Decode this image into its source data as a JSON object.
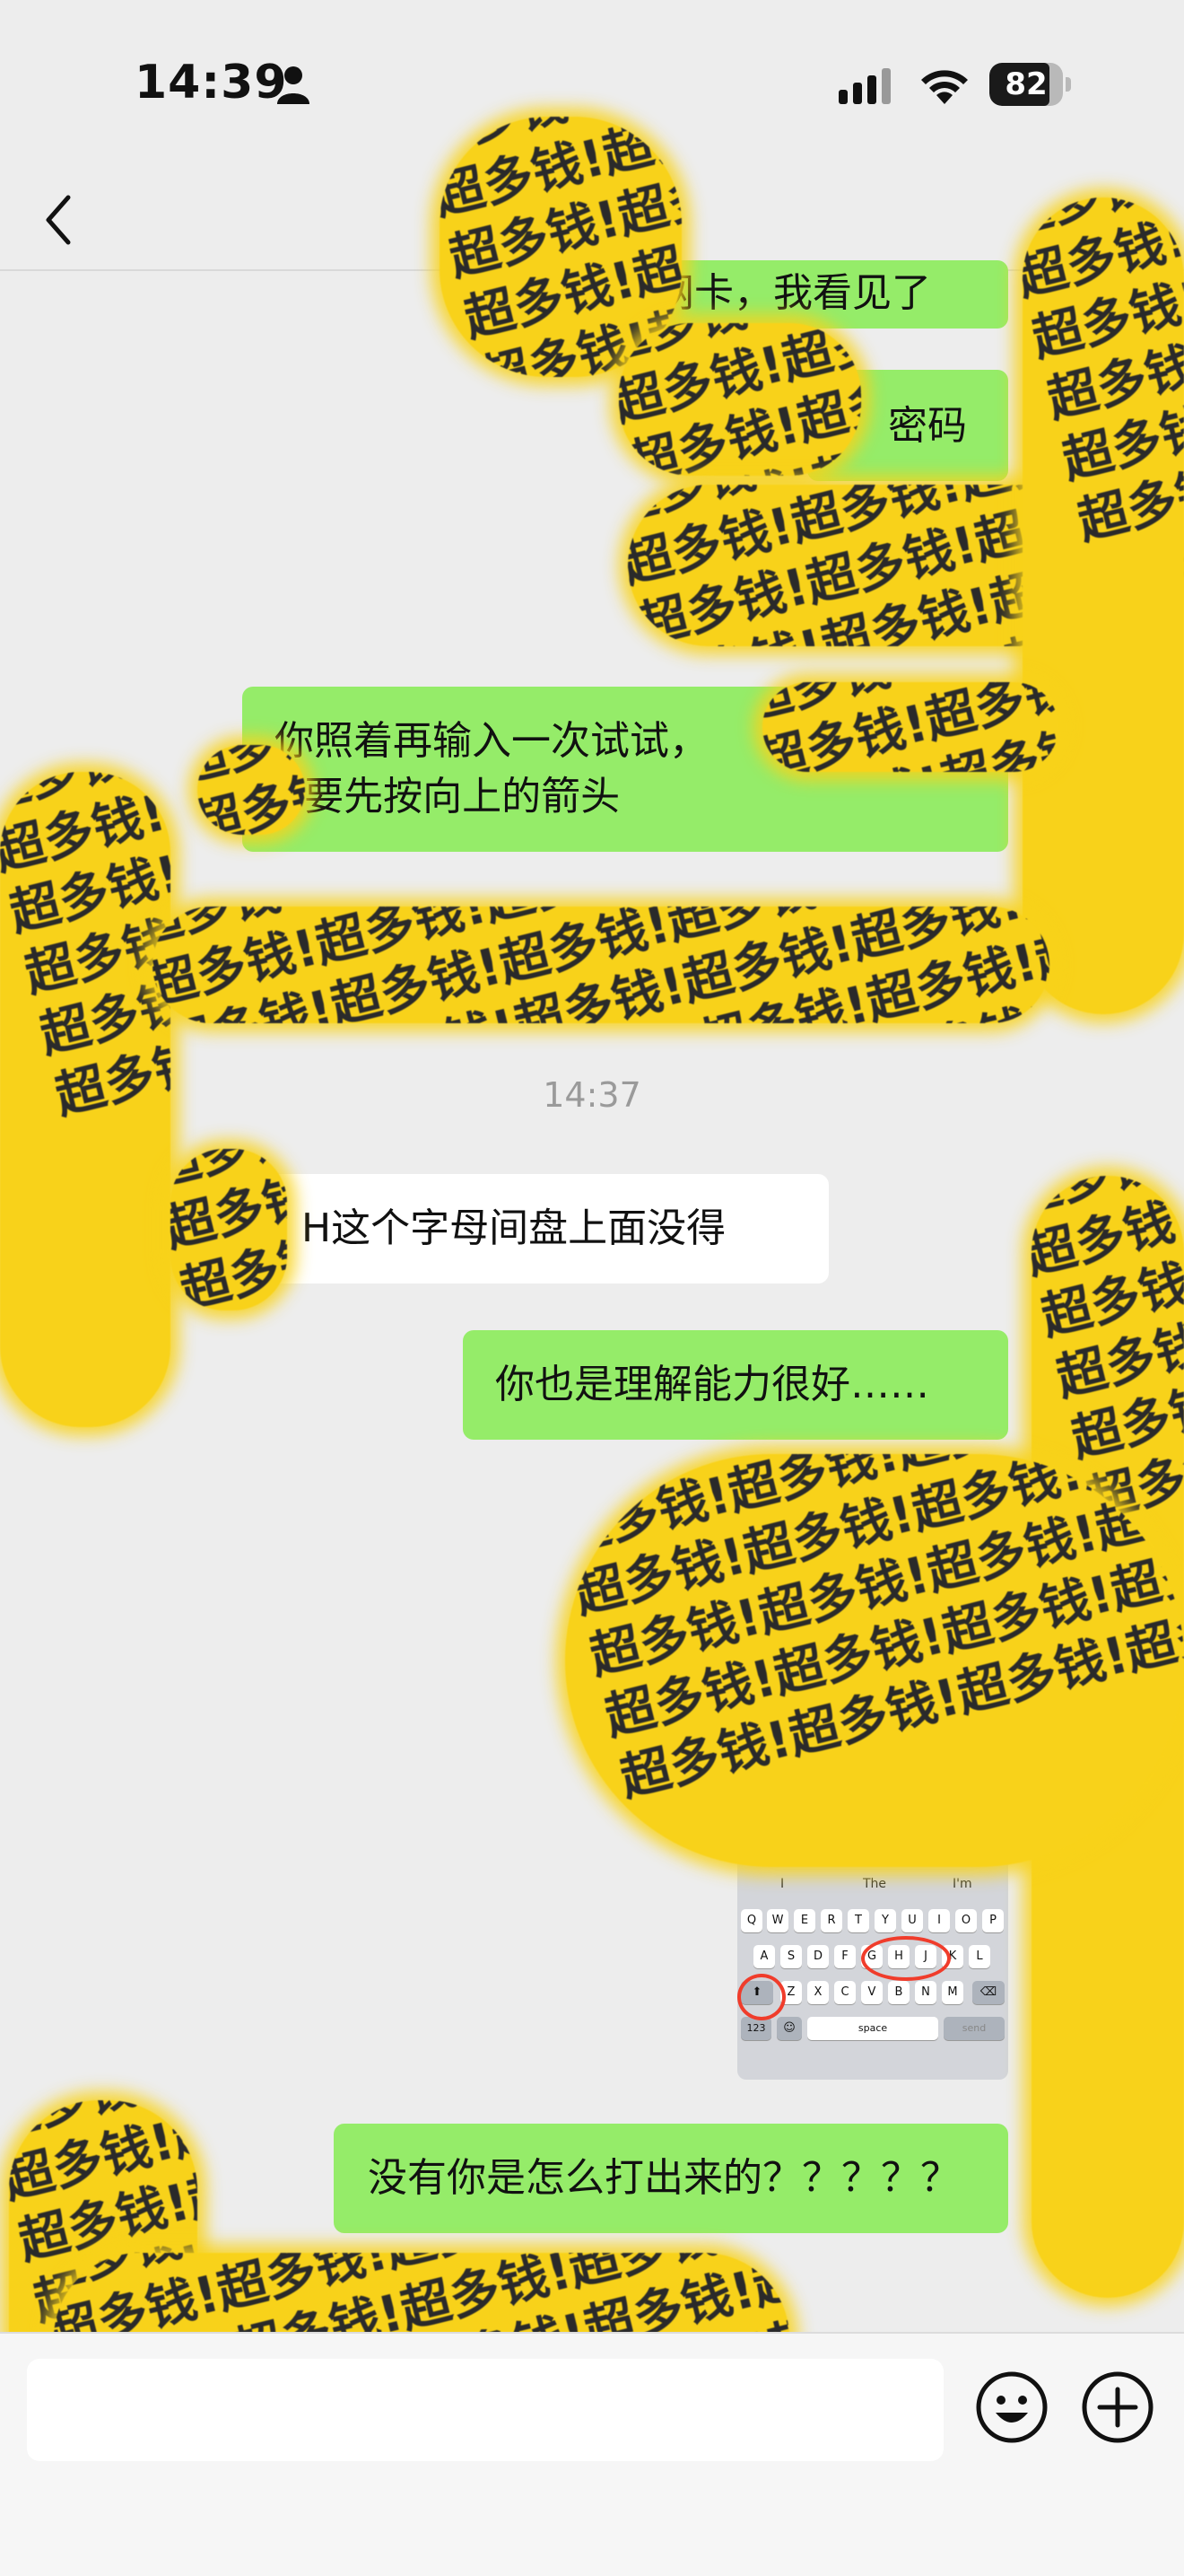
{
  "status_bar": {
    "time": "14:39",
    "battery": "82",
    "battery_level": 0.82
  },
  "nav": {
    "title": ")"
  },
  "messages": [
    {
      "id": "m1",
      "side": "right",
      "color": "green",
      "text": "网卡，我看见了"
    },
    {
      "id": "m2",
      "side": "right",
      "color": "green",
      "text": "密码"
    },
    {
      "id": "m3",
      "side": "right",
      "color": "green",
      "line1": "你照着再输入一次试试，",
      "line2": "H要先按向上的箭头"
    },
    {
      "id": "m4",
      "side": "left",
      "color": "white",
      "text": "H这个字母间盘上面没得"
    },
    {
      "id": "m5",
      "side": "right",
      "color": "green",
      "text": "你也是理解能力很好……"
    },
    {
      "id": "m6",
      "side": "right",
      "color": "green",
      "text": "没有你是怎么打出来的？？？？？"
    }
  ],
  "timestamp": "14:37",
  "keyboard_image": {
    "suggestions": [
      "I",
      "The",
      "I'm"
    ],
    "row1": [
      "Q",
      "W",
      "E",
      "R",
      "T",
      "Y",
      "U",
      "I",
      "O",
      "P"
    ],
    "row2": [
      "A",
      "S",
      "D",
      "F",
      "G",
      "H",
      "J",
      "K",
      "L"
    ],
    "row3": [
      "Z",
      "X",
      "C",
      "V",
      "B",
      "N",
      "M"
    ],
    "mode_key": "123",
    "space_key": "space",
    "send_key": "send"
  },
  "sticker_text": "超多钱!超多钱!超多钱!超多钱!超多钱!超多钱!超多钱!超多钱!超多钱!超多钱!超多钱!超多钱!超多钱!超多钱!超多钱!超多钱!超多钱!超多钱!超多钱!超多钱!超多钱!超多钱!超多钱!超多钱!超多钱!超多钱!超多钱!超多钱!超多钱!超多钱!超多钱!超多钱!超多钱!超多钱!超多钱!超多钱!超多钱!超多钱!超多钱!超多钱!",
  "icons": {
    "person": "person-icon",
    "signal": "signal-icon",
    "wifi": "wifi-icon",
    "back": "chevron-left-icon",
    "emoji": "smiley-icon",
    "plus": "plus-circle-icon"
  }
}
